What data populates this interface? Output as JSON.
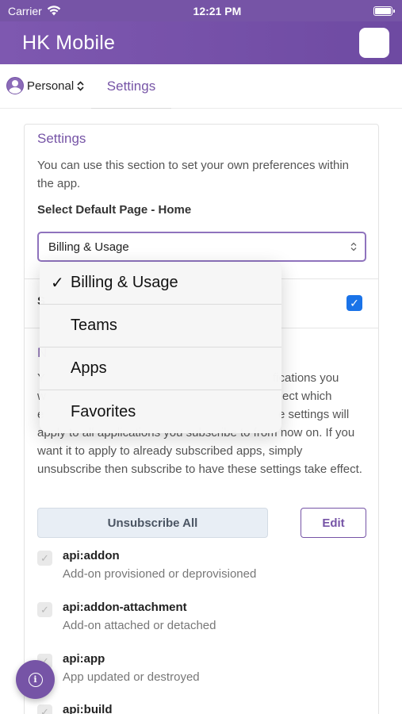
{
  "status_bar": {
    "carrier": "Carrier",
    "time": "12:21 PM",
    "wifi_icon": "wifi-icon",
    "battery_icon": "battery-icon"
  },
  "header": {
    "title": "HK Mobile",
    "avatar_icon": "avatar-square"
  },
  "nav": {
    "account_label": "Personal",
    "tab_label": "Settings"
  },
  "settings": {
    "title": "Settings",
    "description": "You can use this section to set your own preferences within the app.",
    "select_label": "Select Default Page - Home",
    "select_value": "Billing & Usage",
    "second_row_initial": "S",
    "second_row_checked": true,
    "notifications_heading_initial": "N",
    "notifications_line1_tail": "fications you",
    "notifications_line2_start": "w",
    "notifications_line2_tail": "ect which",
    "notifications_line3_start": "e",
    "notifications_line3_tail": "e settings will",
    "notifications_visible": "apply to all applications you subscribe to from now on. If you want it to apply to already subscribed apps, simply unsubscribe then subscribe to have these settings take effect.",
    "unsubscribe_label": "Unsubscribe All",
    "edit_label": "Edit",
    "subscriptions": [
      {
        "name": "api:addon",
        "desc": "Add-on provisioned or deprovisioned"
      },
      {
        "name": "api:addon-attachment",
        "desc": "Add-on attached or detached"
      },
      {
        "name": "api:app",
        "desc": "App updated or destroyed"
      },
      {
        "name": "api:build",
        "desc": ""
      }
    ]
  },
  "dropdown": {
    "options": [
      {
        "label": "Billing & Usage",
        "selected": true
      },
      {
        "label": "Teams",
        "selected": false
      },
      {
        "label": "Apps",
        "selected": false
      },
      {
        "label": "Favorites",
        "selected": false
      }
    ],
    "check_mark": "✓"
  },
  "fab": {
    "icon": "info-icon",
    "glyph": "i"
  },
  "colors": {
    "brand_purple": "#7654a6",
    "checkbox_blue": "#1a73e8"
  }
}
